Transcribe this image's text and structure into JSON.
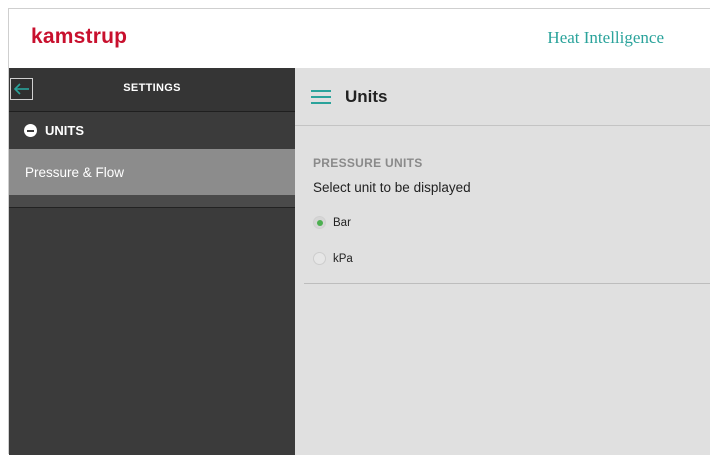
{
  "header": {
    "logo_text": "kamstrup",
    "app_title": "Heat Intelligence",
    "brand_color": "#c8102e",
    "accent_color": "#2aa39b"
  },
  "sidebar": {
    "back_icon": "arrow-left-icon",
    "title": "SETTINGS",
    "section": {
      "icon": "minus-circle-icon",
      "label": "UNITS"
    },
    "items": [
      {
        "label": "Pressure & Flow",
        "selected": true
      }
    ]
  },
  "main": {
    "menu_icon": "hamburger-icon",
    "title": "Units",
    "group": {
      "title": "PRESSURE UNITS",
      "description": "Select unit to be displayed",
      "options": [
        {
          "label": "Bar",
          "checked": true
        },
        {
          "label": "kPa",
          "checked": false
        }
      ],
      "selected_color": "#4caf50"
    }
  }
}
